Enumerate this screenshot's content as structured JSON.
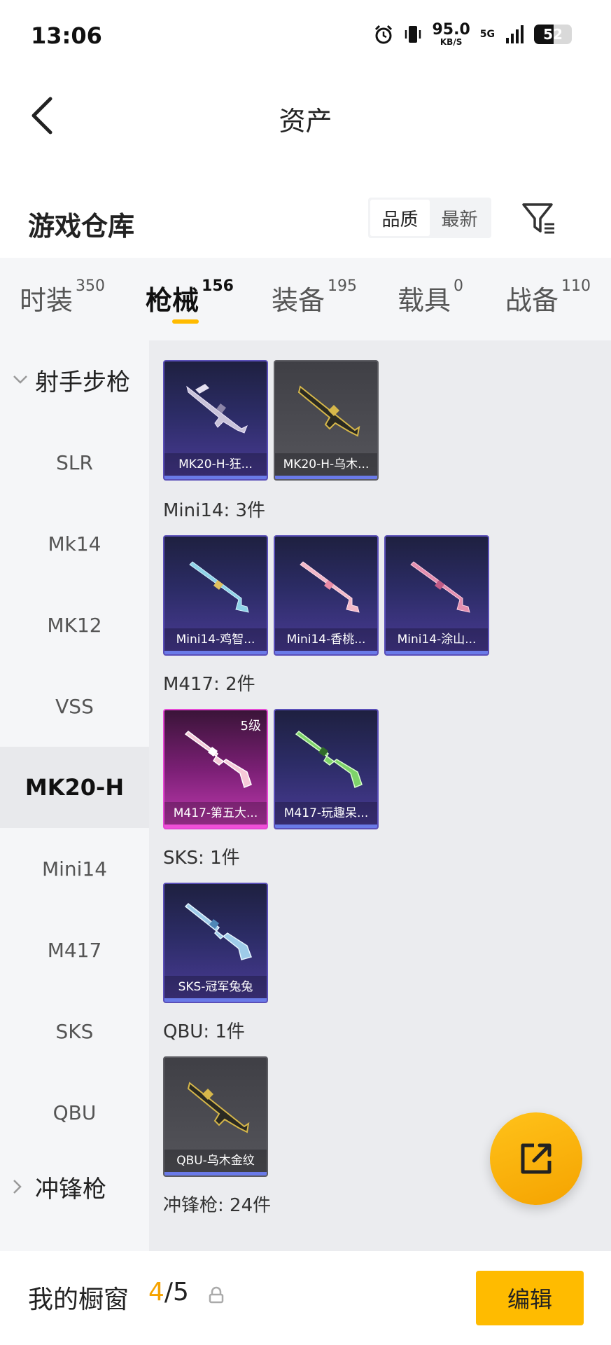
{
  "status_bar": {
    "time": "13:06",
    "speed_value": "95.0",
    "speed_unit": "KB/S",
    "network": "5G",
    "battery": "52"
  },
  "header": {
    "title": "资产"
  },
  "section": {
    "title": "游戏仓库",
    "sort_options": [
      "品质",
      "最新"
    ],
    "active_sort": "品质"
  },
  "tabs": [
    {
      "label": "时装",
      "count": "350"
    },
    {
      "label": "枪械",
      "count": "156"
    },
    {
      "label": "装备",
      "count": "195"
    },
    {
      "label": "载具",
      "count": "0"
    },
    {
      "label": "战备",
      "count": "110"
    }
  ],
  "active_tab": "枪械",
  "categories": {
    "group1": "射手步枪",
    "items": [
      "SLR",
      "Mk14",
      "MK12",
      "VSS",
      "MK20-H",
      "Mini14",
      "M417",
      "SKS",
      "QBU"
    ],
    "active": "MK20-H",
    "group2": "冲锋枪"
  },
  "groups": [
    {
      "label": "",
      "items": [
        "MK20-H-狂...",
        "MK20-H-乌木..."
      ]
    },
    {
      "label": "Mini14: 3件",
      "items": [
        "Mini14-鸡智...",
        "Mini14-香桃...",
        "Mini14-涂山..."
      ]
    },
    {
      "label": "M417: 2件",
      "items": [
        "M417-第五大...",
        "M417-玩趣呆..."
      ],
      "level_badge": "5级"
    },
    {
      "label": "SKS: 1件",
      "items": [
        "SKS-冠军兔兔"
      ]
    },
    {
      "label": "QBU: 1件",
      "items": [
        "QBU-乌木金纹"
      ]
    },
    {
      "label": "冲锋枪: 24件",
      "items": []
    }
  ],
  "bottom_bar": {
    "label": "我的橱窗",
    "current": "4",
    "separator": "/",
    "total": "5",
    "edit_label": "编辑"
  },
  "colors": {
    "accent": "#ffbb00",
    "count_highlight": "#f5a300",
    "purple_card": "#4a3b96",
    "pink_card": "#c03ab0",
    "grey_card": "#56565c"
  }
}
